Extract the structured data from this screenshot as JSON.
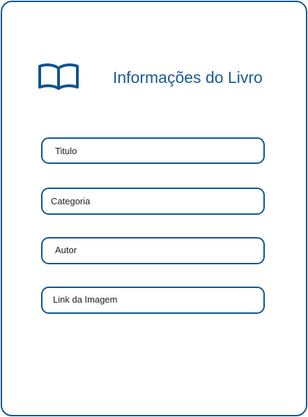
{
  "header": {
    "icon": "open-book-icon",
    "title": "Informações do Livro"
  },
  "form": {
    "fields": [
      {
        "name": "titulo",
        "placeholder": "Titulo"
      },
      {
        "name": "categoria",
        "placeholder": "Categoria"
      },
      {
        "name": "autor",
        "placeholder": "Autor"
      },
      {
        "name": "link_imagem",
        "placeholder": "Link da Imagem"
      }
    ]
  },
  "colors": {
    "accent": "#0c5592",
    "title_text": "#1a5b94",
    "field_text": "#1b1b1b",
    "background": "#ffffff"
  }
}
